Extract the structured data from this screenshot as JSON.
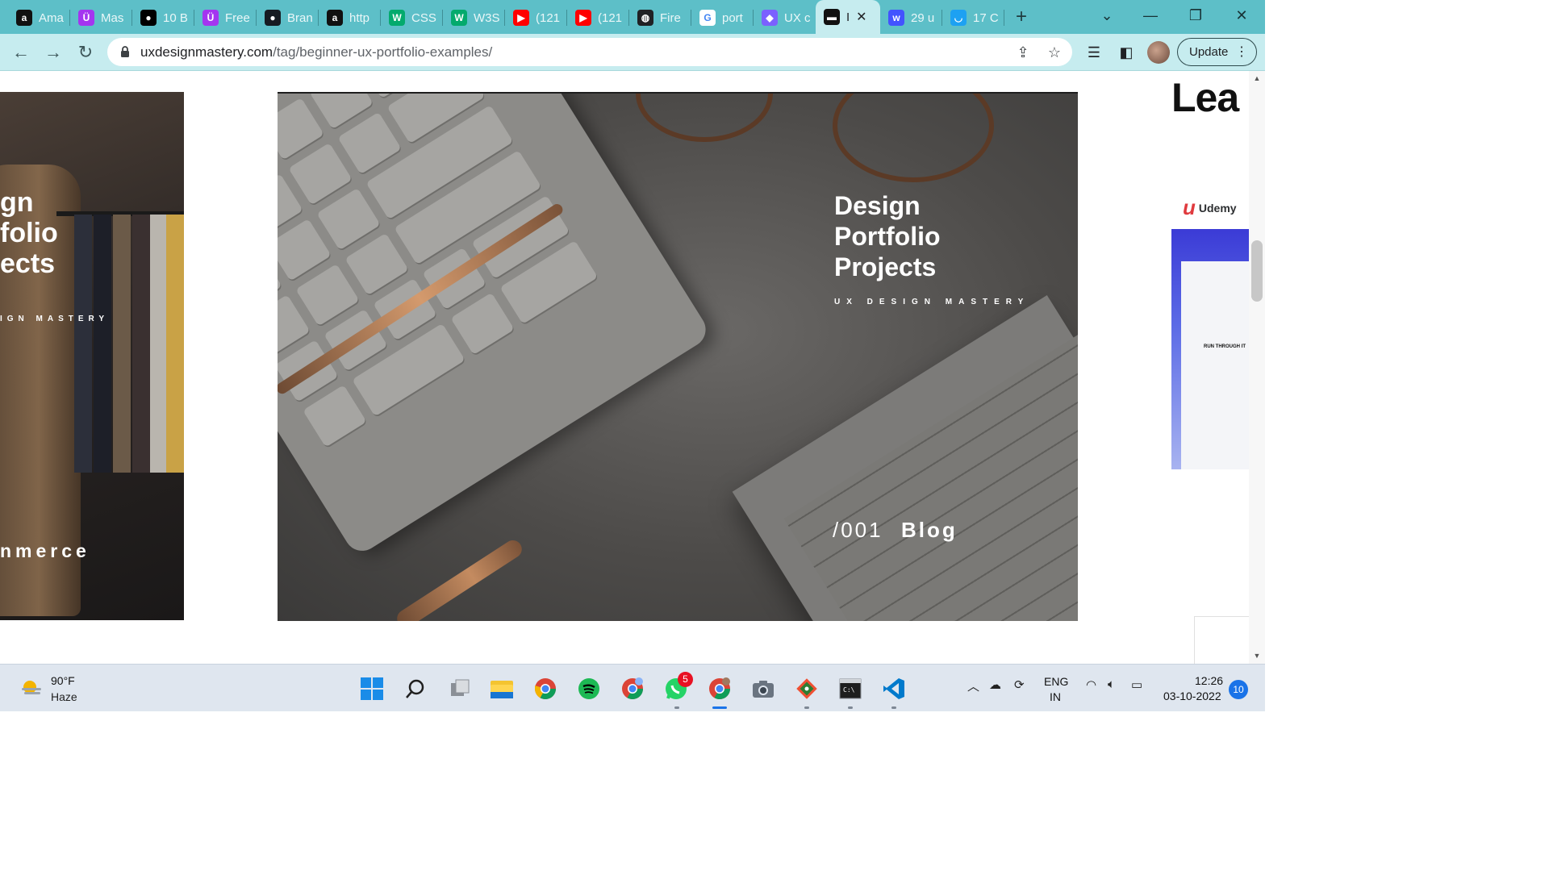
{
  "browser": {
    "tabs": [
      {
        "icon": "amazon-icon",
        "title": "Ama",
        "color": "#111111",
        "glyph": "a"
      },
      {
        "icon": "udemy-icon",
        "title": "Mas",
        "color": "#a435f0",
        "glyph": "Ü"
      },
      {
        "icon": "medium-icon",
        "title": "10 B",
        "color": "#000000",
        "glyph": "●"
      },
      {
        "icon": "udemy-icon",
        "title": "Free",
        "color": "#a435f0",
        "glyph": "Ü"
      },
      {
        "icon": "github-icon",
        "title": "Bran",
        "color": "#161b22",
        "glyph": "●"
      },
      {
        "icon": "amazon-icon",
        "title": "http",
        "color": "#111111",
        "glyph": "a"
      },
      {
        "icon": "w3schools-icon",
        "title": "CSS",
        "color": "#04aa6d",
        "glyph": "W"
      },
      {
        "icon": "w3schools-icon",
        "title": "W3S",
        "color": "#04aa6d",
        "glyph": "W"
      },
      {
        "icon": "youtube-icon",
        "title": "(121",
        "color": "#ff0000",
        "glyph": "▶"
      },
      {
        "icon": "youtube-icon",
        "title": "(121",
        "color": "#ff0000",
        "glyph": "▶"
      },
      {
        "icon": "globe-icon",
        "title": "Fire",
        "color": "#202124",
        "glyph": "◍"
      },
      {
        "icon": "google-icon",
        "title": "port",
        "color": "#ffffff",
        "glyph": "G"
      },
      {
        "icon": "figma-like-icon",
        "title": "UX c",
        "color": "#7b61ff",
        "glyph": "◆"
      },
      {
        "icon": "uxdm-icon",
        "title": "I",
        "color": "#111111",
        "glyph": "▬",
        "active": true
      },
      {
        "icon": "webflow-icon",
        "title": "29 u",
        "color": "#4353ff",
        "glyph": "w"
      },
      {
        "icon": "curve-icon",
        "title": "17 C",
        "color": "#1da1f2",
        "glyph": "◡"
      }
    ],
    "new_tab": "+",
    "url_host": "uxdesignmastery.com",
    "url_path": "/tag/beginner-ux-portfolio-examples/",
    "update_label": "Update"
  },
  "page": {
    "left_card": {
      "title_lines": [
        "gn",
        "folio",
        "ects"
      ],
      "subtitle": "IGN MASTERY",
      "footer": "nmerce"
    },
    "main_card": {
      "title_lines": [
        "Design",
        "Portfolio",
        "Projects"
      ],
      "subtitle": "UX DESIGN MASTERY",
      "number": "/001",
      "label": "Blog"
    },
    "sidebar": {
      "heading": "Lea",
      "ad_brand": "Udemy",
      "ad_text": "RUN THROUGH IT"
    }
  },
  "taskbar": {
    "weather_temp": "90°F",
    "weather_cond": "Haze",
    "whatsapp_badge": "5",
    "lang_line1": "ENG",
    "lang_line2": "IN",
    "time": "12:26",
    "date": "03-10-2022",
    "notifications": "10"
  }
}
